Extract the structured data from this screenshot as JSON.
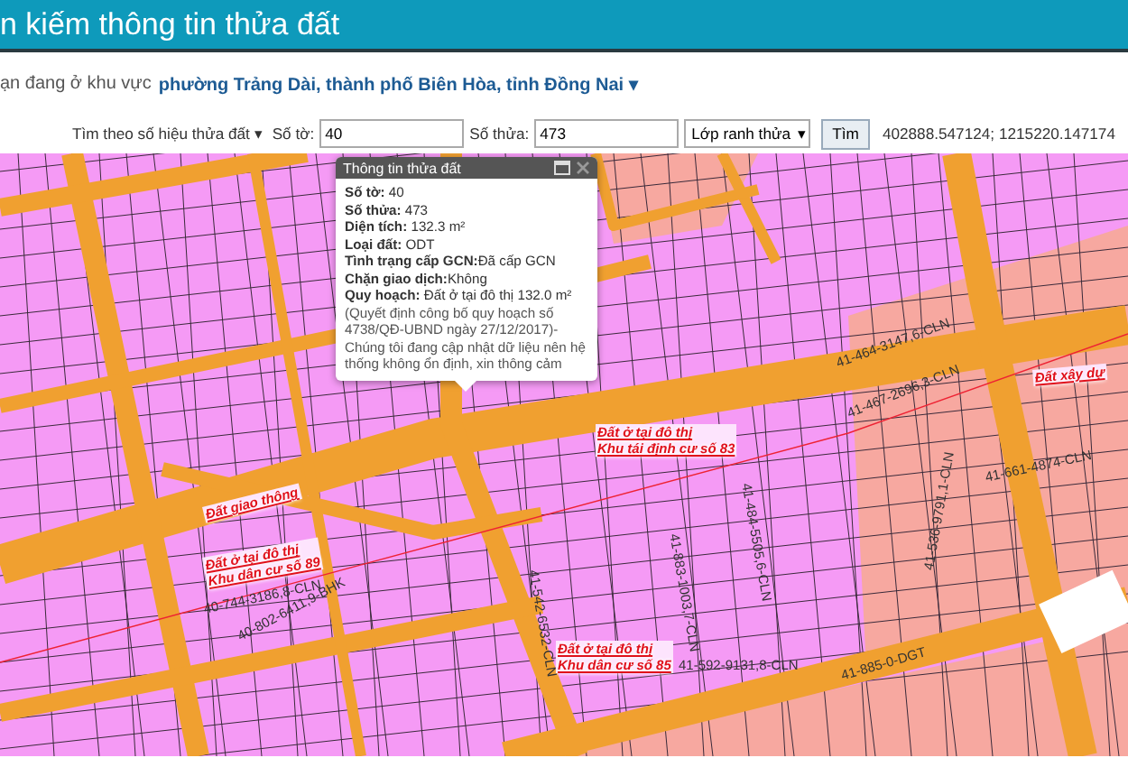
{
  "header": {
    "title": "n kiếm thông tin thửa đất"
  },
  "location": {
    "prefix": "ạn đang ở khu vực",
    "area": "phường Trảng Dài, thành phố Biên Hòa, tỉnh Đồng Nai",
    "caret": "▾"
  },
  "search": {
    "mode": "Tìm theo số hiệu thửa đất",
    "mode_caret": "▾",
    "layer_caret": "▾",
    "sheet_label": "Số tờ:",
    "sheet_value": "40",
    "parcel_label": "Số thửa:",
    "parcel_value": "473",
    "layer": "Lớp ranh thửa",
    "button": "Tìm",
    "coordinates": "402888.547124; 1215220.147174"
  },
  "popup": {
    "title": "Thông tin thửa đất",
    "lines": [
      "**Số tờ:** 40",
      "**Số thửa:** 473",
      "**Diện tích:** 132.3 m²",
      "**Loại đất:** ODT",
      "**Tình trạng cấp GCN:**Đã cấp GCN",
      "**Chặn giao dịch:**Không",
      "**Quy hoạch:** Đất ở tại đô thị 132.0 m²"
    ],
    "note": "(Quyết định công bố quy hoạch số 4738/QĐ-UBND ngày 27/12/2017)- Chúng tôi đang cập nhật dữ liệu nên hệ thống không ổn định, xin thông cảm"
  },
  "map_labels": [
    {
      "kind": "zone",
      "lines": [
        "Đất giao thông"
      ]
    },
    {
      "kind": "zone",
      "lines": [
        "Đất ở tại đô thị",
        "Khu dân cư số 89"
      ]
    },
    {
      "kind": "zone",
      "lines": [
        "Đất ở tại đô thị",
        "Khu tái định cư số 83"
      ]
    },
    {
      "kind": "zone",
      "lines": [
        "Đất ở tại đô thị",
        "Khu dân cư số 85"
      ]
    },
    {
      "kind": "zone",
      "lines": [
        "Đất xây dự"
      ]
    },
    {
      "kind": "parcel",
      "lines": [
        "40-744-3186,8-CLN"
      ]
    },
    {
      "kind": "parcel",
      "lines": [
        "40-802-6411,9-BHK"
      ]
    },
    {
      "kind": "parcel",
      "lines": [
        "41-592-9131,8-CLN"
      ]
    },
    {
      "kind": "parcel",
      "lines": [
        "41-885-0-DGT"
      ]
    },
    {
      "kind": "parcel",
      "lines": [
        "41-464-3147,6-CLN"
      ]
    },
    {
      "kind": "parcel",
      "lines": [
        "41-467-2696,3-CLN"
      ]
    },
    {
      "kind": "parcel",
      "lines": [
        "41-661-4874-CLN"
      ]
    },
    {
      "kind": "parcel",
      "lines": [
        "41-883-1003,7-CLN"
      ]
    },
    {
      "kind": "parcel",
      "lines": [
        "41-484-5505,6-CLN"
      ]
    },
    {
      "kind": "parcel",
      "lines": [
        "41-536-9791,1-CLN"
      ]
    },
    {
      "kind": "parcel",
      "lines": [
        "41-542-6532-CLN"
      ]
    }
  ]
}
